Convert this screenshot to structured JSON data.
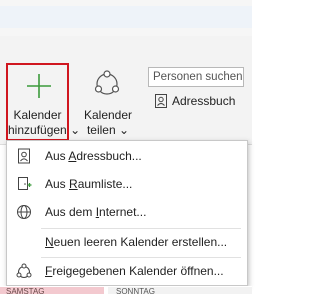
{
  "ribbon": {
    "add_calendar": {
      "line1": "Kalender",
      "line2": "hinzufügen",
      "caret": "⌄"
    },
    "share_calendar": {
      "line1": "Kalender",
      "line2": "teilen",
      "caret": "⌄"
    },
    "search_placeholder": "Personen suchen",
    "address_book_label": "Adressbuch"
  },
  "menu": {
    "items": [
      {
        "icon": "address-book-icon",
        "pre": "Aus ",
        "accel": "A",
        "post": "dressbuch..."
      },
      {
        "icon": "room-list-icon",
        "pre": "Aus ",
        "accel": "R",
        "post": "aumliste..."
      },
      {
        "icon": "globe-icon",
        "pre": "Aus dem ",
        "accel": "I",
        "post": "nternet..."
      },
      {
        "icon": "",
        "pre": "",
        "accel": "N",
        "post": "euen leeren Kalender erstellen..."
      },
      {
        "icon": "shared-calendar-icon",
        "pre": "",
        "accel": "F",
        "post": "reigegebenen Kalender öffnen..."
      }
    ]
  },
  "calendar": {
    "day_saturday": "SAMSTAG",
    "day_sunday": "SONNTAG"
  },
  "colors": {
    "highlight_border": "#d0161f",
    "plus_green": "#3b9a3b",
    "saturday_bg": "#f3c9cf"
  }
}
